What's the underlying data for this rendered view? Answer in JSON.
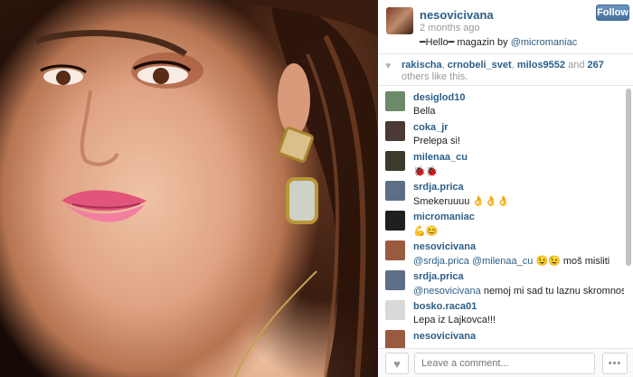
{
  "post": {
    "username": "nesovicivana",
    "time": "2 months ago",
    "caption_prefix": "━Hello━ magazin by ",
    "caption_mention": "@micromaniac",
    "follow_label": "Follow"
  },
  "likes": {
    "heart_icon": "heart-icon",
    "names": [
      "rakischa",
      "crnobeli_svet",
      "milos9552"
    ],
    "count_text": "267",
    "suffix": "others like this."
  },
  "comments": [
    {
      "user": "desiglod10",
      "text": "Bella",
      "mention": "",
      "avatar_color": "#6c8a6a"
    },
    {
      "user": "coka_jr",
      "text": "Prelepa si!",
      "mention": "",
      "avatar_color": "#4a3a33"
    },
    {
      "user": "milenaa_cu",
      "text": "🐞🐞",
      "mention": "",
      "avatar_color": "#3c3a2a"
    },
    {
      "user": "srdja.prica",
      "text": "Smekeruuuu 👌👌👌",
      "mention": "",
      "avatar_color": "#5d6f86"
    },
    {
      "user": "micromaniac",
      "text": "💪😊",
      "mention": "",
      "avatar_color": "#1f1f1f"
    },
    {
      "user": "nesovicivana",
      "mention": "@srdja.prica @milenaa_cu",
      "text": " 😉😉 moš misliti",
      "avatar_color": "#9a5a3f"
    },
    {
      "user": "srdja.prica",
      "mention": "@nesovicivana",
      "text": " nemoj mi sad tu laznu skromnost 😂😂😂",
      "avatar_color": "#5d6f86"
    },
    {
      "user": "bosko.raca01",
      "text": "Lepa iz Lajkovca!!!",
      "mention": "",
      "avatar_color": "#d9d9d9"
    },
    {
      "user": "nesovicivana",
      "text": "",
      "mention": "",
      "avatar_color": "#9a5a3f"
    }
  ],
  "footer": {
    "like_icon": "heart-icon",
    "comment_placeholder": "Leave a comment...",
    "more_label": "•••"
  },
  "colors": {
    "link": "#2c5e89",
    "follow_button": "#517fa4"
  }
}
